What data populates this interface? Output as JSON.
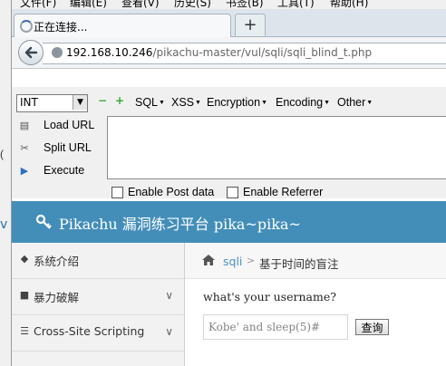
{
  "browser": {
    "menu": [
      "文件(F)",
      "编辑(E)",
      "查看(V)",
      "历史(S)",
      "书签(B)",
      "工具(T)",
      "帮助(H)"
    ],
    "tab_title": "正在连接...",
    "new_tab_label": "+",
    "url_host": "192.168.10.246",
    "url_path": "/pikachu-master/vul/sqli/sqli_blind_t.php"
  },
  "hackbar": {
    "select_value": "INT",
    "select_arrow": "▼",
    "minus_label": "−",
    "plus_label": "+",
    "menus": [
      "SQL",
      "XSS",
      "Encryption",
      "Encoding",
      "Other"
    ],
    "actions": [
      "Load URL",
      "Split URL",
      "Execute"
    ],
    "textarea_value": "",
    "checkboxes": [
      "Enable Post data",
      "Enable Referrer"
    ]
  },
  "page": {
    "header_title": "Pikachu 漏洞练习平台 pika~pika~",
    "left_edge_trunc": "v",
    "sidebar": [
      {
        "label": "系统介绍",
        "icon": "tag-icon",
        "has_chevron": false
      },
      {
        "label": "暴力破解",
        "icon": "lock-icon",
        "has_chevron": true
      },
      {
        "label": "Cross-Site Scripting",
        "icon": "list-icon",
        "has_chevron": true
      }
    ],
    "breadcrumb": {
      "link": "sqli",
      "separator": ">",
      "current": "基于时间的盲注"
    },
    "question": "what's your username?",
    "input_value": "Kobe' and sleep(5)#",
    "submit_label": "查询"
  },
  "colors": {
    "header_bg": "#438eb9",
    "link": "#4c8fbd"
  }
}
